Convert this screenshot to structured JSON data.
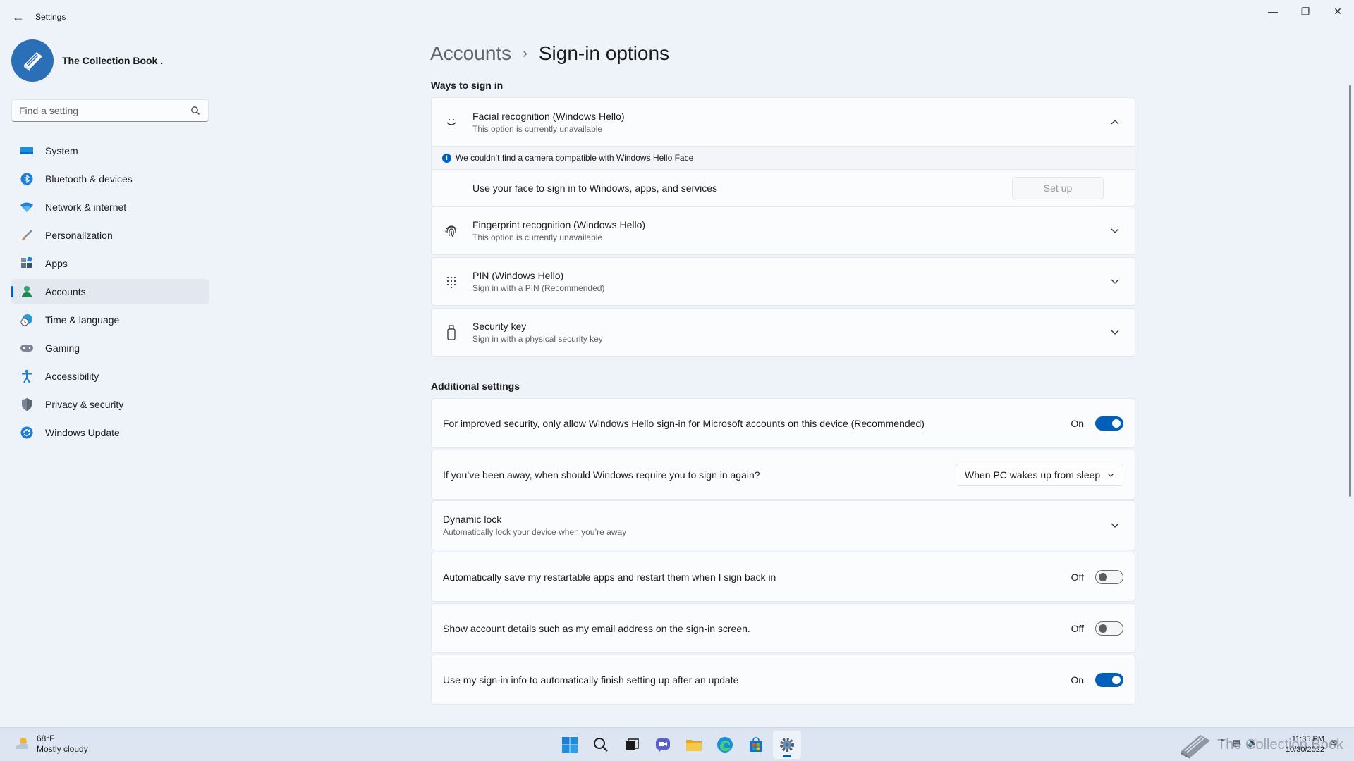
{
  "window": {
    "title": "Settings"
  },
  "profile": {
    "name": "The Collection Book ."
  },
  "search": {
    "placeholder": "Find a setting"
  },
  "sidebar": {
    "items": [
      {
        "label": "System",
        "icon": "monitor-icon",
        "active": false
      },
      {
        "label": "Bluetooth & devices",
        "icon": "bluetooth-icon",
        "active": false
      },
      {
        "label": "Network & internet",
        "icon": "wifi-icon",
        "active": false
      },
      {
        "label": "Personalization",
        "icon": "brush-icon",
        "active": false
      },
      {
        "label": "Apps",
        "icon": "apps-icon",
        "active": false
      },
      {
        "label": "Accounts",
        "icon": "person-icon",
        "active": true
      },
      {
        "label": "Time & language",
        "icon": "globe-clock-icon",
        "active": false
      },
      {
        "label": "Gaming",
        "icon": "gamepad-icon",
        "active": false
      },
      {
        "label": "Accessibility",
        "icon": "accessibility-icon",
        "active": false
      },
      {
        "label": "Privacy & security",
        "icon": "shield-icon",
        "active": false
      },
      {
        "label": "Windows Update",
        "icon": "update-icon",
        "active": false
      }
    ]
  },
  "breadcrumb": {
    "parent": "Accounts",
    "separator": "›",
    "current": "Sign-in options"
  },
  "ways": {
    "heading": "Ways to sign in",
    "facial": {
      "title": "Facial recognition (Windows Hello)",
      "subtitle": "This option is currently unavailable",
      "info": "We couldn’t find a camera compatible with Windows Hello Face",
      "action_text": "Use your face to sign in to Windows, apps, and services",
      "button": "Set up",
      "expanded": true
    },
    "fingerprint": {
      "title": "Fingerprint recognition (Windows Hello)",
      "subtitle": "This option is currently unavailable"
    },
    "pin": {
      "title": "PIN (Windows Hello)",
      "subtitle": "Sign in with a PIN (Recommended)"
    },
    "security_key": {
      "title": "Security key",
      "subtitle": "Sign in with a physical security key"
    }
  },
  "additional": {
    "heading": "Additional settings",
    "hello_only": {
      "label": "For improved security, only allow Windows Hello sign-in for Microsoft accounts on this device (Recommended)",
      "state": "On"
    },
    "require_signin": {
      "label": "If you’ve been away, when should Windows require you to sign in again?",
      "value": "When PC wakes up from sleep"
    },
    "dynamic_lock": {
      "title": "Dynamic lock",
      "subtitle": "Automatically lock your device when you’re away"
    },
    "restart_apps": {
      "label": "Automatically save my restartable apps and restart them when I sign back in",
      "state": "Off"
    },
    "account_details": {
      "label": "Show account details such as my email address on the sign-in screen.",
      "state": "Off"
    },
    "signin_info": {
      "label": "Use my sign-in info to automatically finish setting up after an update",
      "state": "On"
    }
  },
  "taskbar": {
    "weather_temp": "68°F",
    "weather_desc": "Mostly cloudy",
    "watermark": "The Collection Book",
    "time": "11:35 PM",
    "date": "10/30/2022"
  },
  "colors": {
    "accent": "#005fb8",
    "background": "#eef2f9",
    "card": "#fbfcfe"
  }
}
